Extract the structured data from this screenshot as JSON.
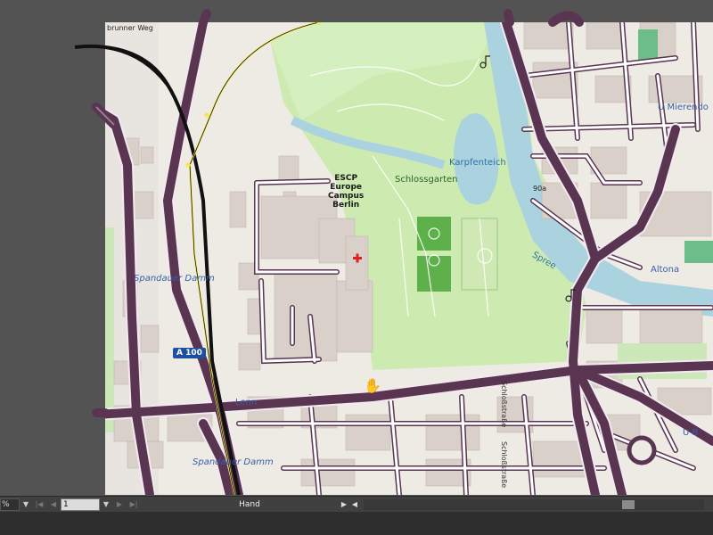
{
  "map": {
    "labels": {
      "street_top": "brunner Weg",
      "spandauer_damm_west": "Spandauer Damm",
      "spandauer_damm_south": "Spandauer Damm",
      "escp": "ESCP\nEurope\nCampus\nBerlin",
      "karpfenteich": "Karpfenteich",
      "schlossgarten": "Schlossgarten",
      "spree": "Spree",
      "altonaer": "Altona",
      "mierendorff": "U Mierendo",
      "a100": "A 100",
      "b90": "90a",
      "schlossstrasse_1": "Schloßstraße",
      "schlossstrasse_2": "Schloßstraße",
      "lenn": "Lenn",
      "u_right": "U B"
    },
    "colors": {
      "road_major": "#5a3552",
      "road_outline": "#f3e9f0",
      "park": "#cdebb0",
      "park_dark": "#b9dca0",
      "lawn": "#5eb14a",
      "water": "#aad3df",
      "building": "#d9d0c9",
      "building_dark": "#c9bcb4",
      "rail": "#111111",
      "selection_path": "#f5e94a"
    }
  },
  "cursor": {
    "icon": "hand-icon"
  },
  "statusbar": {
    "zoom_value": "%",
    "page_value": "1",
    "current_tool": "Hand"
  }
}
